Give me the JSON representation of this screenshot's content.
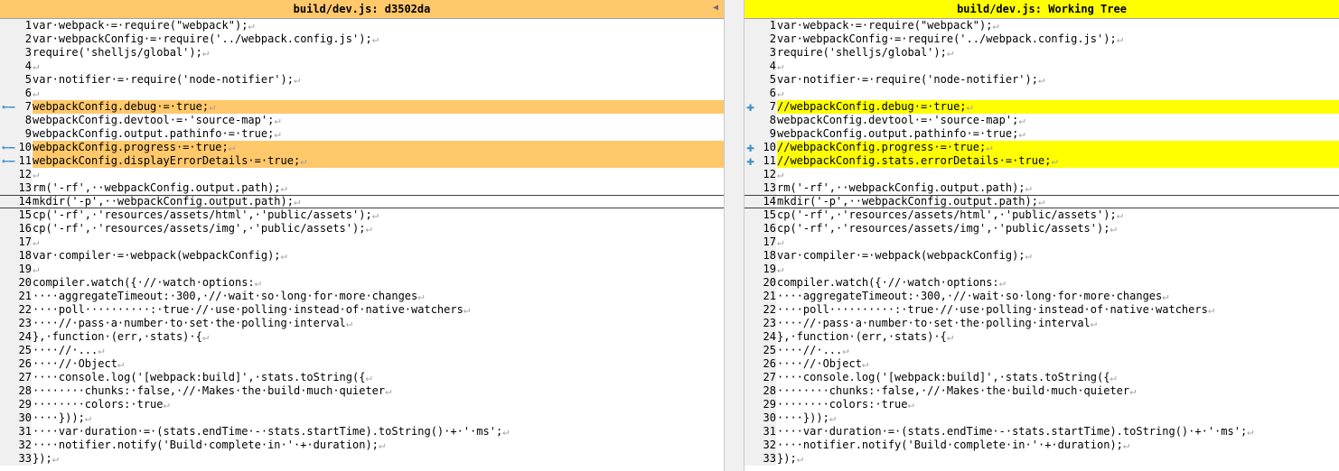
{
  "left": {
    "title": "build/dev.js: d3502da",
    "lines": [
      {
        "n": "1",
        "t": "var·webpack·=·require(\"webpack\");"
      },
      {
        "n": "2",
        "t": "var·webpackConfig·=·require('../webpack.config.js');"
      },
      {
        "n": "3",
        "t": "require('shelljs/global');"
      },
      {
        "n": "4",
        "t": ""
      },
      {
        "n": "5",
        "t": "var·notifier·=·require('node-notifier');"
      },
      {
        "n": "6",
        "t": ""
      },
      {
        "n": "7",
        "t": "webpackConfig.debug·=·true;",
        "chg": true
      },
      {
        "n": "8",
        "t": "webpackConfig.devtool·=·'source-map';"
      },
      {
        "n": "9",
        "t": "webpackConfig.output.pathinfo·=·true;"
      },
      {
        "n": "10",
        "t": "webpackConfig.progress·=·true;",
        "chg": true
      },
      {
        "n": "11",
        "t": "webpackConfig.displayErrorDetails·=·true;",
        "chg": true
      },
      {
        "n": "12",
        "t": ""
      },
      {
        "n": "13",
        "t": "rm('-rf',··webpackConfig.output.path);"
      },
      {
        "n": "14",
        "t": "mkdir('-p',··webpackConfig.output.path);",
        "cur": true
      },
      {
        "n": "15",
        "t": "cp('-rf',·'resources/assets/html',·'public/assets');"
      },
      {
        "n": "16",
        "t": "cp('-rf',·'resources/assets/img',·'public/assets');"
      },
      {
        "n": "17",
        "t": ""
      },
      {
        "n": "18",
        "t": "var·compiler·=·webpack(webpackConfig);"
      },
      {
        "n": "19",
        "t": ""
      },
      {
        "n": "20",
        "t": "compiler.watch({·//·watch·options:"
      },
      {
        "n": "21",
        "t": "····aggregateTimeout:·300,·//·wait·so·long·for·more·changes"
      },
      {
        "n": "22",
        "t": "····poll··········:·true·//·use·polling·instead·of·native·watchers"
      },
      {
        "n": "23",
        "t": "····//·pass·a·number·to·set·the·polling·interval"
      },
      {
        "n": "24",
        "t": "},·function·(err,·stats)·{"
      },
      {
        "n": "25",
        "t": "····//·..."
      },
      {
        "n": "26",
        "t": "····//·Object"
      },
      {
        "n": "27",
        "t": "····console.log('[webpack:build]',·stats.toString({"
      },
      {
        "n": "28",
        "t": "········chunks:·false,·//·Makes·the·build·much·quieter"
      },
      {
        "n": "29",
        "t": "········colors:·true"
      },
      {
        "n": "30",
        "t": "····}));"
      },
      {
        "n": "31",
        "t": "····var·duration·=·(stats.endTime·-·stats.startTime).toString()·+·'·ms';"
      },
      {
        "n": "32",
        "t": "····notifier.notify('Build·complete·in·'·+·duration);"
      },
      {
        "n": "33",
        "t": "});"
      }
    ]
  },
  "right": {
    "title": "build/dev.js: Working Tree",
    "lines": [
      {
        "n": "1",
        "t": "var·webpack·=·require(\"webpack\");"
      },
      {
        "n": "2",
        "t": "var·webpackConfig·=·require('../webpack.config.js');"
      },
      {
        "n": "3",
        "t": "require('shelljs/global');"
      },
      {
        "n": "4",
        "t": ""
      },
      {
        "n": "5",
        "t": "var·notifier·=·require('node-notifier');"
      },
      {
        "n": "6",
        "t": ""
      },
      {
        "n": "7",
        "t": "//webpackConfig.debug·=·true;",
        "chg": true
      },
      {
        "n": "8",
        "t": "webpackConfig.devtool·=·'source-map';"
      },
      {
        "n": "9",
        "t": "webpackConfig.output.pathinfo·=·true;"
      },
      {
        "n": "10",
        "t": "//webpackConfig.progress·=·true;",
        "chg": true
      },
      {
        "n": "11",
        "t": "//webpackConfig.stats.errorDetails·=·true;",
        "chg": true
      },
      {
        "n": "12",
        "t": ""
      },
      {
        "n": "13",
        "t": "rm('-rf',··webpackConfig.output.path);"
      },
      {
        "n": "14",
        "t": "mkdir('-p',··webpackConfig.output.path);",
        "cur": true
      },
      {
        "n": "15",
        "t": "cp('-rf',·'resources/assets/html',·'public/assets');"
      },
      {
        "n": "16",
        "t": "cp('-rf',·'resources/assets/img',·'public/assets');"
      },
      {
        "n": "17",
        "t": ""
      },
      {
        "n": "18",
        "t": "var·compiler·=·webpack(webpackConfig);"
      },
      {
        "n": "19",
        "t": ""
      },
      {
        "n": "20",
        "t": "compiler.watch({·//·watch·options:"
      },
      {
        "n": "21",
        "t": "····aggregateTimeout:·300,·//·wait·so·long·for·more·changes"
      },
      {
        "n": "22",
        "t": "····poll··········:·true·//·use·polling·instead·of·native·watchers"
      },
      {
        "n": "23",
        "t": "····//·pass·a·number·to·set·the·polling·interval"
      },
      {
        "n": "24",
        "t": "},·function·(err,·stats)·{"
      },
      {
        "n": "25",
        "t": "····//·..."
      },
      {
        "n": "26",
        "t": "····//·Object"
      },
      {
        "n": "27",
        "t": "····console.log('[webpack:build]',·stats.toString({"
      },
      {
        "n": "28",
        "t": "········chunks:·false,·//·Makes·the·build·much·quieter"
      },
      {
        "n": "29",
        "t": "········colors:·true"
      },
      {
        "n": "30",
        "t": "····}));"
      },
      {
        "n": "31",
        "t": "····var·duration·=·(stats.endTime·-·stats.startTime).toString()·+·'·ms';"
      },
      {
        "n": "32",
        "t": "····notifier.notify('Build·complete·in·'·+·duration);"
      },
      {
        "n": "33",
        "t": "});"
      }
    ]
  },
  "icons": {
    "removed": "minus-arrow-icon",
    "added": "plus-icon",
    "eol": "return-arrow-icon",
    "scroll": "scroll-arrow-icon"
  },
  "colors": {
    "left_change": "#ffc86a",
    "right_change": "#ffff00",
    "word_highlight": "#d9d9f3",
    "word_removed": "#d97060",
    "marker": "#3a8fc6"
  }
}
